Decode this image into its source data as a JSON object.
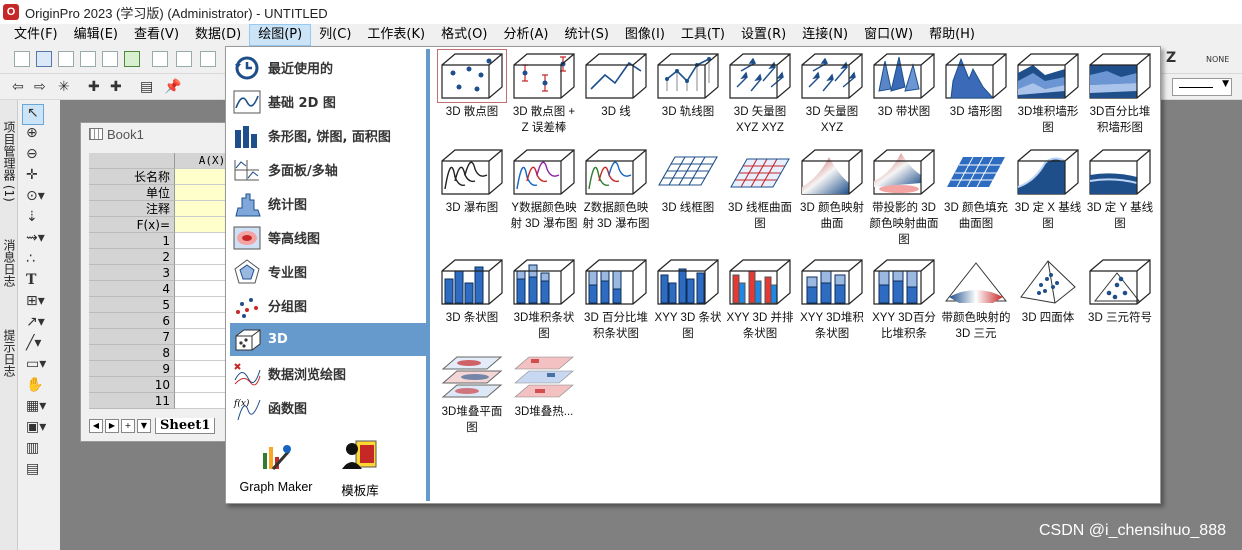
{
  "window": {
    "title": "OriginPro 2023 (学习版) (Administrator) - UNTITLED"
  },
  "menu": {
    "items": [
      {
        "label": "文件(F)"
      },
      {
        "label": "编辑(E)"
      },
      {
        "label": "查看(V)"
      },
      {
        "label": "数据(D)"
      },
      {
        "label": "绘图(P)",
        "active": true
      },
      {
        "label": "列(C)"
      },
      {
        "label": "工作表(K)"
      },
      {
        "label": "格式(O)"
      },
      {
        "label": "分析(A)"
      },
      {
        "label": "统计(S)"
      },
      {
        "label": "图像(I)"
      },
      {
        "label": "工具(T)"
      },
      {
        "label": "设置(R)"
      },
      {
        "label": "连接(N)"
      },
      {
        "label": "窗口(W)"
      },
      {
        "label": "帮助(H)"
      }
    ]
  },
  "toolbar": {
    "right_letter": "Z",
    "right_label": "NONE"
  },
  "side_tabs": [
    "项目管理器 (1)",
    "消息日志",
    "提示日志"
  ],
  "book": {
    "title": "Book1",
    "column_header": "A(X)",
    "row_labels": [
      "长名称",
      "单位",
      "注释",
      "F(x)="
    ],
    "row_numbers": [
      "1",
      "2",
      "3",
      "4",
      "5",
      "6",
      "7",
      "8",
      "9",
      "10",
      "11"
    ],
    "sheet_tab": "Sheet1"
  },
  "plot_menu": {
    "categories": [
      {
        "label": "最近使用的",
        "icon": "clock-icon"
      },
      {
        "label": "基础 2D 图",
        "icon": "line-chart-icon"
      },
      {
        "label": "条形图, 饼图, 面积图",
        "icon": "bar-chart-icon"
      },
      {
        "label": "多面板/多轴",
        "icon": "multi-panel-icon"
      },
      {
        "label": "统计图",
        "icon": "histogram-icon"
      },
      {
        "label": "等高线图",
        "icon": "contour-icon"
      },
      {
        "label": "专业图",
        "icon": "polar-icon"
      },
      {
        "label": "分组图",
        "icon": "grouped-scatter-icon"
      },
      {
        "label": "3D",
        "icon": "cube-3d-icon",
        "active": true
      },
      {
        "label": "数据浏览绘图",
        "icon": "data-explore-icon"
      },
      {
        "label": "函数图",
        "icon": "function-icon"
      }
    ],
    "makers": [
      {
        "label": "Graph Maker",
        "icon": "graph-maker-icon"
      },
      {
        "label": "模板库",
        "icon": "template-library-icon"
      }
    ],
    "templates": [
      {
        "label": "3D 散点图",
        "icon": "scatter-3d-icon",
        "selected": true
      },
      {
        "label": "3D 散点图 + Z 误差棒",
        "icon": "scatter-zerror-3d-icon"
      },
      {
        "label": "3D 线",
        "icon": "line-3d-icon"
      },
      {
        "label": "3D 轨线图",
        "icon": "trajectory-3d-icon"
      },
      {
        "label": "3D 矢量图 XYZ XYZ",
        "icon": "vector-xyzxyz-icon"
      },
      {
        "label": "3D 矢量图 XYZ",
        "icon": "vector-xyz-icon"
      },
      {
        "label": "3D 带状图",
        "icon": "ribbon-3d-icon"
      },
      {
        "label": "3D 墙形图",
        "icon": "wall-3d-icon"
      },
      {
        "label": "3D堆积墙形图",
        "icon": "stacked-wall-icon"
      },
      {
        "label": "3D百分比堆积墙形图",
        "icon": "percent-stacked-wall-icon"
      },
      {
        "label": "3D 瀑布图",
        "icon": "waterfall-3d-icon"
      },
      {
        "label": "Y数据颜色映射 3D 瀑布图",
        "icon": "waterfall-ycolor-icon"
      },
      {
        "label": "Z数据颜色映射 3D 瀑布图",
        "icon": "waterfall-zcolor-icon"
      },
      {
        "label": "3D 线框图",
        "icon": "wireframe-icon"
      },
      {
        "label": "3D 线框曲面图",
        "icon": "wireframe-surface-icon"
      },
      {
        "label": "3D 颜色映射曲面",
        "icon": "colormap-surface-icon"
      },
      {
        "label": "带投影的 3D 颜色映射曲面图",
        "icon": "projection-surface-icon"
      },
      {
        "label": "3D 颜色填充曲面图",
        "icon": "colorfill-surface-icon"
      },
      {
        "label": "3D 定 X 基线图",
        "icon": "x-baseline-icon"
      },
      {
        "label": "3D 定 Y 基线图",
        "icon": "y-baseline-icon"
      },
      {
        "label": "3D 条状图",
        "icon": "bars-3d-icon"
      },
      {
        "label": "3D堆积条状图",
        "icon": "stacked-bars-3d-icon"
      },
      {
        "label": "3D 百分比堆积条状图",
        "icon": "percent-bars-3d-icon"
      },
      {
        "label": "XYY 3D 条状图",
        "icon": "xyy-bars-icon"
      },
      {
        "label": "XYY 3D 并排条状图",
        "icon": "xyy-side-bars-icon"
      },
      {
        "label": "XYY 3D堆积条状图",
        "icon": "xyy-stacked-icon"
      },
      {
        "label": "XYY 3D百分比堆积条",
        "icon": "xyy-percent-icon"
      },
      {
        "label": "带颜色映射的 3D 三元",
        "icon": "ternary-colormap-icon"
      },
      {
        "label": "3D 四面体",
        "icon": "tetrahedron-icon"
      },
      {
        "label": "3D 三元符号",
        "icon": "ternary-symbol-icon"
      },
      {
        "label": "3D堆叠平面图",
        "icon": "stacked-planes-icon"
      },
      {
        "label": "3D堆叠热...",
        "icon": "stacked-heatmap-icon"
      }
    ]
  },
  "watermark": "CSDN @i_chensihuo_888"
}
